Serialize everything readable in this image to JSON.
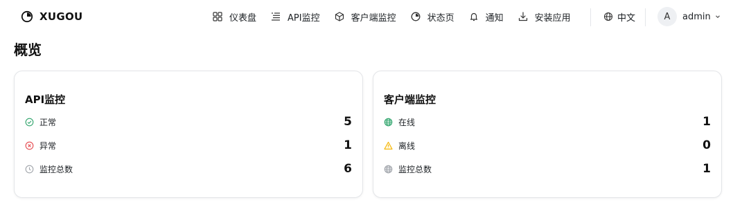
{
  "brand": {
    "name": "XUGOU"
  },
  "nav": {
    "items": [
      {
        "label": "仪表盘",
        "icon": "dashboard-grid-icon"
      },
      {
        "label": "API监控",
        "icon": "list-icon"
      },
      {
        "label": "客户端监控",
        "icon": "cube-icon"
      },
      {
        "label": "状态页",
        "icon": "status-icon"
      },
      {
        "label": "通知",
        "icon": "bell-icon"
      },
      {
        "label": "安装应用",
        "icon": "download-icon"
      }
    ]
  },
  "language": {
    "label": "中文",
    "icon": "globe-icon"
  },
  "user": {
    "avatar_initial": "A",
    "name": "admin"
  },
  "page": {
    "title": "概览"
  },
  "cards": {
    "api": {
      "title": "API监控",
      "rows": [
        {
          "label": "正常",
          "value": "5",
          "icon": "check-circle-icon"
        },
        {
          "label": "异常",
          "value": "1",
          "icon": "x-circle-icon"
        },
        {
          "label": "监控总数",
          "value": "6",
          "icon": "clock-icon"
        }
      ]
    },
    "client": {
      "title": "客户端监控",
      "rows": [
        {
          "label": "在线",
          "value": "1",
          "icon": "globe-online-icon"
        },
        {
          "label": "离线",
          "value": "0",
          "icon": "warning-triangle-icon"
        },
        {
          "label": "监控总数",
          "value": "1",
          "icon": "globe-total-icon"
        }
      ]
    }
  },
  "colors": {
    "success": "#30a46c",
    "danger": "#e5484d",
    "warning": "#f5b400",
    "muted": "#a0a4aa"
  }
}
